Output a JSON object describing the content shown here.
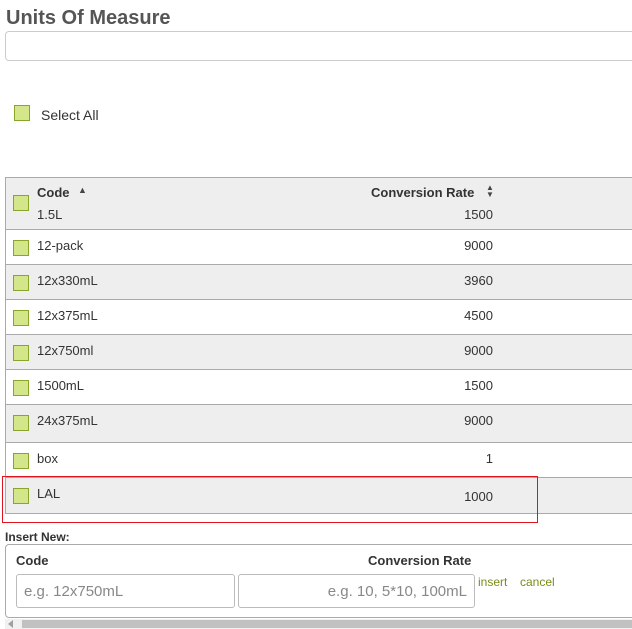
{
  "page": {
    "title": "Units Of Measure"
  },
  "search": {
    "value": "",
    "placeholder": ""
  },
  "select_all": {
    "label": "Select All",
    "checked": false
  },
  "table": {
    "columns": {
      "code": "Code",
      "conversion_rate": "Conversion Rate"
    },
    "sort": {
      "code": "ascending",
      "conversion_rate": "unsorted"
    },
    "rows": [
      {
        "code": "1.5L",
        "rate": "1500"
      },
      {
        "code": "12-pack",
        "rate": "9000"
      },
      {
        "code": "12x330mL",
        "rate": "3960"
      },
      {
        "code": "12x375mL",
        "rate": "4500"
      },
      {
        "code": "12x750ml",
        "rate": "9000"
      },
      {
        "code": "1500mL",
        "rate": "1500"
      },
      {
        "code": "24x375mL",
        "rate": "9000"
      },
      {
        "code": "box",
        "rate": "1"
      },
      {
        "code": "LAL",
        "rate": "1000"
      }
    ],
    "highlighted_row": "LAL"
  },
  "insert": {
    "title": "Insert New:",
    "code_label": "Code",
    "rate_label": "Conversion Rate",
    "code_placeholder": "e.g. 12x750mL",
    "rate_placeholder": "e.g. 10, 5*10, 100mL",
    "insert_link": "insert",
    "cancel_link": "cancel"
  },
  "colors": {
    "checkbox_fill": "#d4e68a",
    "checkbox_border": "#8aa62a",
    "alt_row": "#eeeeee",
    "highlight_border": "#e0141e",
    "link": "#7a8a1a"
  },
  "icons": {
    "code_sort": "sort-ascending-icon",
    "rate_sort": "sort-both-icon",
    "scroll_left": "scroll-left-arrow-icon"
  }
}
